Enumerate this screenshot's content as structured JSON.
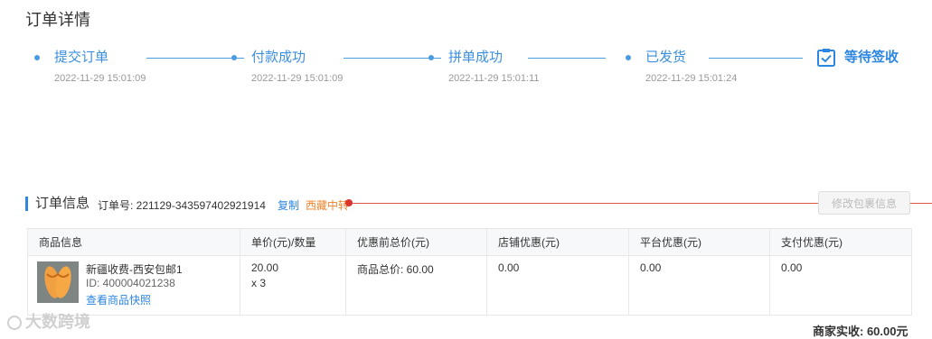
{
  "page": {
    "title": "订单详情"
  },
  "steps": [
    {
      "label": "提交订单",
      "time": "2022-11-29 15:01:09"
    },
    {
      "label": "付款成功",
      "time": "2022-11-29 15:01:09"
    },
    {
      "label": "拼单成功",
      "time": "2022-11-29 15:01:11"
    },
    {
      "label": "已发货",
      "time": "2022-11-29 15:01:24"
    }
  ],
  "current_step": {
    "label": "等待签收",
    "icon": "clipboard-check-icon"
  },
  "order_info": {
    "heading": "订单信息",
    "order_no_label": "订单号: 221129-343597402921914",
    "copy_label": "复制",
    "tag": "西藏中转",
    "modify_button": "修改包裹信息"
  },
  "table": {
    "headers": [
      "商品信息",
      "单价(元)/数量",
      "优惠前总价(元)",
      "店铺优惠(元)",
      "平台优惠(元)",
      "支付优惠(元)"
    ],
    "row": {
      "product_name": "新疆收费-西安包邮1",
      "product_id": "ID: 400004021238",
      "snapshot_link": "查看商品快照",
      "unit_price": "20.00",
      "quantity": "x 3",
      "total_before": "商品总价: 60.00",
      "shop_discount": "0.00",
      "platform_discount": "0.00",
      "payment_discount": "0.00"
    }
  },
  "summary": {
    "merchant_received": "商家实收: 60.00元"
  },
  "watermark": {
    "text": "大数跨境"
  },
  "colors": {
    "accent": "#2d86e0",
    "tag": "#f0842b",
    "red_line": "#e0584d"
  }
}
